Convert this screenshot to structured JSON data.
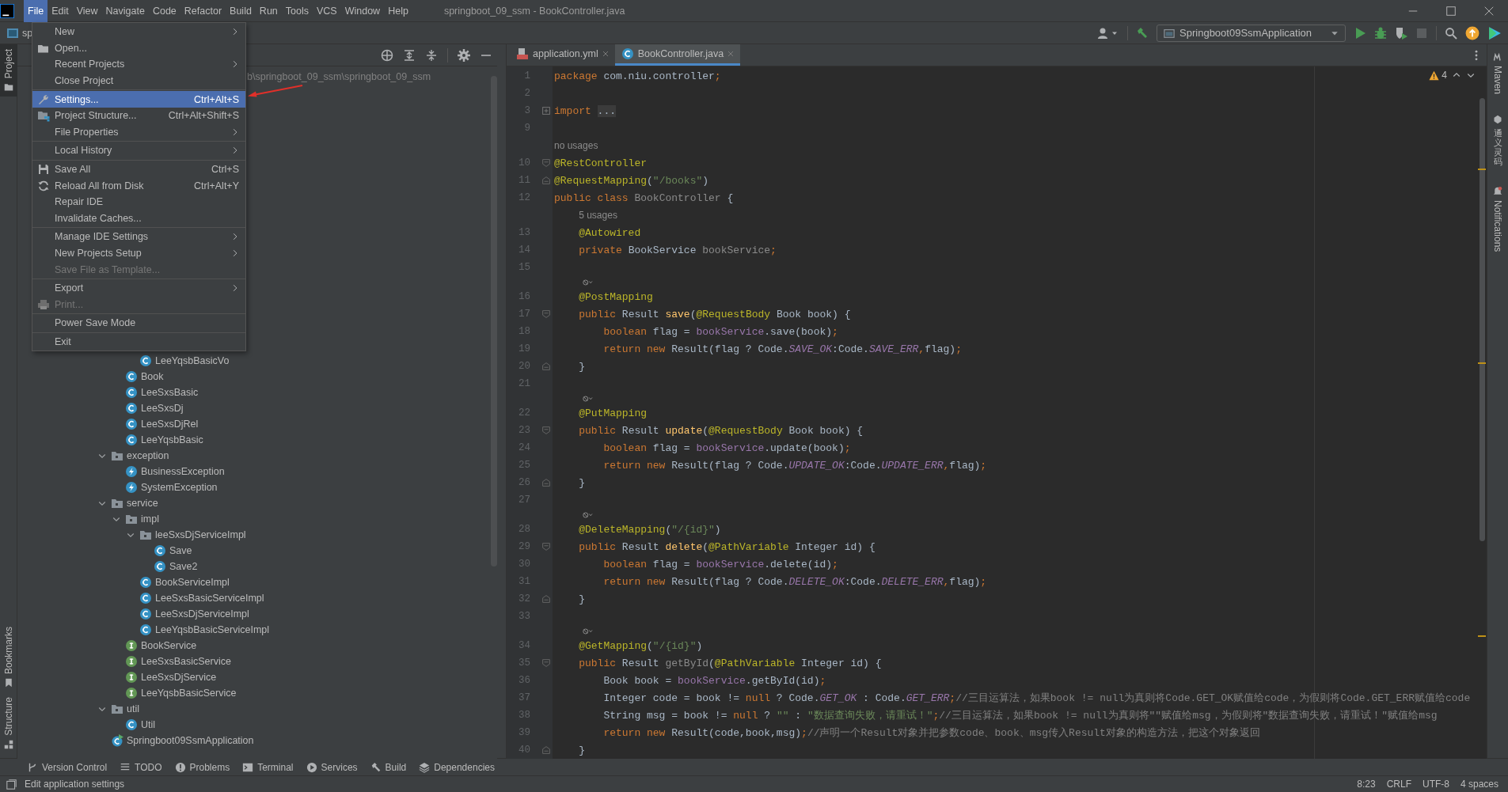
{
  "window": {
    "title": "springboot_09_ssm - BookController.java"
  },
  "menu_bar": [
    {
      "label": "File",
      "selected": true
    },
    {
      "label": "Edit",
      "selected": false
    },
    {
      "label": "View",
      "selected": false
    },
    {
      "label": "Navigate",
      "selected": false
    },
    {
      "label": "Code",
      "selected": false
    },
    {
      "label": "Refactor",
      "selected": false
    },
    {
      "label": "Build",
      "selected": false
    },
    {
      "label": "Run",
      "selected": false
    },
    {
      "label": "Tools",
      "selected": false
    },
    {
      "label": "VCS",
      "selected": false
    },
    {
      "label": "Window",
      "selected": false
    },
    {
      "label": "Help",
      "selected": false
    }
  ],
  "file_menu": {
    "groups": [
      [
        {
          "label": "New",
          "submenu": true,
          "selected": false,
          "disabled": false
        },
        {
          "label": "Open...",
          "submenu": false,
          "selected": false,
          "disabled": false
        },
        {
          "label": "Recent Projects",
          "submenu": true,
          "selected": false,
          "disabled": false
        },
        {
          "label": "Close Project",
          "submenu": false,
          "selected": false,
          "disabled": false
        }
      ],
      [
        {
          "label": "Settings...",
          "shortcut": "Ctrl+Alt+S",
          "submenu": false,
          "selected": true,
          "disabled": false
        },
        {
          "label": "Project Structure...",
          "shortcut": "Ctrl+Alt+Shift+S",
          "submenu": false,
          "selected": false,
          "disabled": false
        },
        {
          "label": "File Properties",
          "submenu": true,
          "selected": false,
          "disabled": false
        }
      ],
      [
        {
          "label": "Local History",
          "submenu": true,
          "selected": false,
          "disabled": false
        }
      ],
      [
        {
          "label": "Save All",
          "shortcut": "Ctrl+S",
          "submenu": false,
          "selected": false,
          "disabled": false
        },
        {
          "label": "Reload All from Disk",
          "shortcut": "Ctrl+Alt+Y",
          "submenu": false,
          "selected": false,
          "disabled": false
        },
        {
          "label": "Repair IDE",
          "submenu": false,
          "selected": false,
          "disabled": false
        },
        {
          "label": "Invalidate Caches...",
          "submenu": false,
          "selected": false,
          "disabled": false
        }
      ],
      [
        {
          "label": "Manage IDE Settings",
          "submenu": true,
          "selected": false,
          "disabled": false
        },
        {
          "label": "New Projects Setup",
          "submenu": true,
          "selected": false,
          "disabled": false
        },
        {
          "label": "Save File as Template...",
          "submenu": false,
          "selected": false,
          "disabled": true
        }
      ],
      [
        {
          "label": "Export",
          "submenu": true,
          "selected": false,
          "disabled": false
        },
        {
          "label": "Print...",
          "submenu": false,
          "selected": false,
          "disabled": true
        }
      ],
      [
        {
          "label": "Power Save Mode",
          "submenu": false,
          "selected": false,
          "disabled": false
        }
      ],
      [
        {
          "label": "Exit",
          "submenu": false,
          "selected": false,
          "disabled": false
        }
      ]
    ]
  },
  "navigation": {
    "breadcrumb": "sp"
  },
  "toolbar": {
    "run_configuration": "Springboot09SsmApplication"
  },
  "left_strip": {
    "top": [
      {
        "label": "Project",
        "selected": true
      }
    ],
    "bottom": [
      {
        "label": "Bookmarks",
        "selected": false
      },
      {
        "label": "Structure",
        "selected": false
      }
    ]
  },
  "project_panel": {
    "path": "b\\springboot_09_ssm\\springboot_09_ssm",
    "tree": [
      {
        "children": [
          {
            "children": [
              {
                "label": "LeeYqsbBasicVo",
                "kind": "class"
              }
            ]
          },
          {
            "label": "Book",
            "kind": "class"
          },
          {
            "label": "LeeSxsBasic",
            "kind": "class"
          },
          {
            "label": "LeeSxsDj",
            "kind": "class"
          },
          {
            "label": "LeeSxsDjRel",
            "kind": "class"
          },
          {
            "label": "LeeYqsbBasic",
            "kind": "class"
          }
        ]
      },
      {
        "label": "exception",
        "kind": "folder",
        "expanded": true,
        "children": [
          {
            "label": "BusinessException",
            "kind": "exception"
          },
          {
            "label": "SystemException",
            "kind": "exception"
          }
        ]
      },
      {
        "label": "service",
        "kind": "folder",
        "expanded": true,
        "children": [
          {
            "label": "impl",
            "kind": "folder",
            "expanded": true,
            "children": [
              {
                "label": "leeSxsDjServiceImpl",
                "kind": "folder",
                "expanded": true,
                "children": [
                  {
                    "label": "Save",
                    "kind": "class"
                  },
                  {
                    "label": "Save2",
                    "kind": "class"
                  }
                ]
              },
              {
                "label": "BookServiceImpl",
                "kind": "class"
              },
              {
                "label": "LeeSxsBasicServiceImpl",
                "kind": "class"
              },
              {
                "label": "LeeSxsDjServiceImpl",
                "kind": "class"
              },
              {
                "label": "LeeYqsbBasicServiceImpl",
                "kind": "class"
              }
            ]
          },
          {
            "label": "BookService",
            "kind": "interface"
          },
          {
            "label": "LeeSxsBasicService",
            "kind": "interface"
          },
          {
            "label": "LeeSxsDjService",
            "kind": "interface"
          },
          {
            "label": "LeeYqsbBasicService",
            "kind": "interface"
          }
        ]
      },
      {
        "label": "util",
        "kind": "folder",
        "expanded": true,
        "children": [
          {
            "label": "Util",
            "kind": "class"
          }
        ]
      },
      {
        "label": "Springboot09SsmApplication",
        "kind": "app"
      }
    ]
  },
  "editor": {
    "tabs": [
      {
        "label": "application.yml",
        "kind": "yaml",
        "selected": false
      },
      {
        "label": "BookController.java",
        "kind": "java",
        "selected": true
      }
    ],
    "warnings": "4",
    "lines": [
      {
        "kind": "code",
        "number": "1",
        "tokens": [
          {
            "kind": "kw",
            "text": "package"
          },
          {
            "kind": "plain",
            "text": " com.niu.controller"
          },
          {
            "kind": "kw",
            "text": ";"
          }
        ]
      },
      {
        "kind": "code",
        "number": "2"
      },
      {
        "kind": "code",
        "number": "3",
        "collapsed": true,
        "tokens": [
          {
            "kind": "kw",
            "text": "import "
          },
          {
            "kind": "folded",
            "text": "..."
          }
        ]
      },
      {
        "kind": "code",
        "number": "9"
      },
      {
        "kind": "hint",
        "text": "no usages"
      },
      {
        "kind": "code",
        "number": "10",
        "fold_start": true,
        "tokens": [
          {
            "kind": "ann",
            "text": "@RestController"
          }
        ]
      },
      {
        "kind": "code",
        "number": "11",
        "fold_end": true,
        "tokens": [
          {
            "kind": "ann",
            "text": "@RequestMapping"
          },
          {
            "kind": "plain",
            "text": "("
          },
          {
            "kind": "str",
            "text": "\"/books\""
          },
          {
            "kind": "plain",
            "text": ")"
          }
        ]
      },
      {
        "kind": "code",
        "number": "12",
        "tokens": [
          {
            "kind": "kw",
            "text": "public class "
          },
          {
            "kind": "dim",
            "text": "BookController"
          },
          {
            "kind": "plain",
            "text": " {"
          }
        ]
      },
      {
        "kind": "hint",
        "text": "5 usages"
      },
      {
        "kind": "code",
        "number": "13",
        "tokens": [
          {
            "kind": "ann",
            "text": "    @Autowired"
          }
        ]
      },
      {
        "kind": "code",
        "number": "14",
        "tokens": [
          {
            "kind": "kw",
            "text": "    private "
          },
          {
            "kind": "plain",
            "text": "BookService "
          },
          {
            "kind": "dim",
            "text": "bookService"
          },
          {
            "kind": "kw",
            "text": ";"
          }
        ]
      },
      {
        "kind": "code",
        "number": "15"
      },
      {
        "kind": "inlay"
      },
      {
        "kind": "code",
        "number": "16",
        "tokens": [
          {
            "kind": "ann",
            "text": "    @PostMapping"
          }
        ]
      },
      {
        "kind": "code",
        "number": "17",
        "fold_start": true,
        "tokens": [
          {
            "kind": "kw",
            "text": "    public "
          },
          {
            "kind": "plain",
            "text": "Result "
          },
          {
            "kind": "method",
            "text": "save"
          },
          {
            "kind": "plain",
            "text": "("
          },
          {
            "kind": "ann",
            "text": "@RequestBody"
          },
          {
            "kind": "plain",
            "text": " Book book) {"
          }
        ]
      },
      {
        "kind": "code",
        "number": "18",
        "tokens": [
          {
            "kind": "kw",
            "text": "        boolean "
          },
          {
            "kind": "plain",
            "text": "flag = "
          },
          {
            "kind": "member",
            "text": "bookService"
          },
          {
            "kind": "plain",
            "text": ".save(book)"
          },
          {
            "kind": "kw",
            "text": ";"
          }
        ]
      },
      {
        "kind": "code",
        "number": "19",
        "tokens": [
          {
            "kind": "kw",
            "text": "        return new "
          },
          {
            "kind": "plain",
            "text": "Result(flag ? Code."
          },
          {
            "kind": "field",
            "text": "SAVE_OK"
          },
          {
            "kind": "plain",
            "text": ":Code."
          },
          {
            "kind": "field",
            "text": "SAVE_ERR"
          },
          {
            "kind": "kw",
            "text": ","
          },
          {
            "kind": "plain",
            "text": "flag)"
          },
          {
            "kind": "kw",
            "text": ";"
          }
        ]
      },
      {
        "kind": "code",
        "number": "20",
        "fold_end": true,
        "tokens": [
          {
            "kind": "plain",
            "text": "    }"
          }
        ]
      },
      {
        "kind": "code",
        "number": "21"
      },
      {
        "kind": "inlay"
      },
      {
        "kind": "code",
        "number": "22",
        "tokens": [
          {
            "kind": "ann",
            "text": "    @PutMapping"
          }
        ]
      },
      {
        "kind": "code",
        "number": "23",
        "fold_start": true,
        "tokens": [
          {
            "kind": "kw",
            "text": "    public "
          },
          {
            "kind": "plain",
            "text": "Result "
          },
          {
            "kind": "method",
            "text": "update"
          },
          {
            "kind": "plain",
            "text": "("
          },
          {
            "kind": "ann",
            "text": "@RequestBody"
          },
          {
            "kind": "plain",
            "text": " Book book) {"
          }
        ]
      },
      {
        "kind": "code",
        "number": "24",
        "tokens": [
          {
            "kind": "kw",
            "text": "        boolean "
          },
          {
            "kind": "plain",
            "text": "flag = "
          },
          {
            "kind": "member",
            "text": "bookService"
          },
          {
            "kind": "plain",
            "text": ".update(book)"
          },
          {
            "kind": "kw",
            "text": ";"
          }
        ]
      },
      {
        "kind": "code",
        "number": "25",
        "tokens": [
          {
            "kind": "kw",
            "text": "        return new "
          },
          {
            "kind": "plain",
            "text": "Result(flag ? Code."
          },
          {
            "kind": "field",
            "text": "UPDATE_OK"
          },
          {
            "kind": "plain",
            "text": ":Code."
          },
          {
            "kind": "field",
            "text": "UPDATE_ERR"
          },
          {
            "kind": "kw",
            "text": ","
          },
          {
            "kind": "plain",
            "text": "flag)"
          },
          {
            "kind": "kw",
            "text": ";"
          }
        ]
      },
      {
        "kind": "code",
        "number": "26",
        "fold_end": true,
        "tokens": [
          {
            "kind": "plain",
            "text": "    }"
          }
        ]
      },
      {
        "kind": "code",
        "number": "27"
      },
      {
        "kind": "inlay"
      },
      {
        "kind": "code",
        "number": "28",
        "tokens": [
          {
            "kind": "ann",
            "text": "    @DeleteMapping"
          },
          {
            "kind": "plain",
            "text": "("
          },
          {
            "kind": "str",
            "text": "\"/{id}\""
          },
          {
            "kind": "plain",
            "text": ")"
          }
        ]
      },
      {
        "kind": "code",
        "number": "29",
        "fold_start": true,
        "tokens": [
          {
            "kind": "kw",
            "text": "    public "
          },
          {
            "kind": "plain",
            "text": "Result "
          },
          {
            "kind": "method",
            "text": "delete"
          },
          {
            "kind": "plain",
            "text": "("
          },
          {
            "kind": "ann",
            "text": "@PathVariable"
          },
          {
            "kind": "plain",
            "text": " Integer id) {"
          }
        ]
      },
      {
        "kind": "code",
        "number": "30",
        "tokens": [
          {
            "kind": "kw",
            "text": "        boolean "
          },
          {
            "kind": "plain",
            "text": "flag = "
          },
          {
            "kind": "member",
            "text": "bookService"
          },
          {
            "kind": "plain",
            "text": ".delete(id)"
          },
          {
            "kind": "kw",
            "text": ";"
          }
        ]
      },
      {
        "kind": "code",
        "number": "31",
        "tokens": [
          {
            "kind": "kw",
            "text": "        return new "
          },
          {
            "kind": "plain",
            "text": "Result(flag ? Code."
          },
          {
            "kind": "field",
            "text": "DELETE_OK"
          },
          {
            "kind": "plain",
            "text": ":Code."
          },
          {
            "kind": "field",
            "text": "DELETE_ERR"
          },
          {
            "kind": "kw",
            "text": ","
          },
          {
            "kind": "plain",
            "text": "flag)"
          },
          {
            "kind": "kw",
            "text": ";"
          }
        ]
      },
      {
        "kind": "code",
        "number": "32",
        "fold_end": true,
        "tokens": [
          {
            "kind": "plain",
            "text": "    }"
          }
        ]
      },
      {
        "kind": "code",
        "number": "33"
      },
      {
        "kind": "inlay"
      },
      {
        "kind": "code",
        "number": "34",
        "tokens": [
          {
            "kind": "ann",
            "text": "    @GetMapping"
          },
          {
            "kind": "plain",
            "text": "("
          },
          {
            "kind": "str",
            "text": "\"/{id}\""
          },
          {
            "kind": "plain",
            "text": ")"
          }
        ]
      },
      {
        "kind": "code",
        "number": "35",
        "fold_start": true,
        "tokens": [
          {
            "kind": "kw",
            "text": "    public "
          },
          {
            "kind": "plain",
            "text": "Result "
          },
          {
            "kind": "dim",
            "text": "getById"
          },
          {
            "kind": "plain",
            "text": "("
          },
          {
            "kind": "ann",
            "text": "@PathVariable"
          },
          {
            "kind": "plain",
            "text": " Integer id) {"
          }
        ]
      },
      {
        "kind": "code",
        "number": "36",
        "tokens": [
          {
            "kind": "plain",
            "text": "        Book book = "
          },
          {
            "kind": "member",
            "text": "bookService"
          },
          {
            "kind": "plain",
            "text": ".getById(id)"
          },
          {
            "kind": "kw",
            "text": ";"
          }
        ]
      },
      {
        "kind": "code",
        "number": "37",
        "tokens": [
          {
            "kind": "plain",
            "text": "        Integer code = book != "
          },
          {
            "kind": "kw",
            "text": "null"
          },
          {
            "kind": "plain",
            "text": " ? Code."
          },
          {
            "kind": "field",
            "text": "GET_OK"
          },
          {
            "kind": "plain",
            "text": " : Code."
          },
          {
            "kind": "field",
            "text": "GET_ERR"
          },
          {
            "kind": "kw",
            "text": ";"
          },
          {
            "kind": "comment",
            "text": "//三目运算法，如果book != null为真则将Code.GET_OK赋值给code，为假则将Code.GET_ERR赋值给code"
          }
        ]
      },
      {
        "kind": "code",
        "number": "38",
        "tokens": [
          {
            "kind": "plain",
            "text": "        String msg = book != "
          },
          {
            "kind": "kw",
            "text": "null"
          },
          {
            "kind": "plain",
            "text": " ? "
          },
          {
            "kind": "str",
            "text": "\"\""
          },
          {
            "kind": "plain",
            "text": " : "
          },
          {
            "kind": "str",
            "text": "\"数据查询失败，请重试！\""
          },
          {
            "kind": "kw",
            "text": ";"
          },
          {
            "kind": "comment",
            "text": "//三目运算法，如果book != null为真则将\"\"赋值给msg，为假则将\"数据查询失败，请重试！\"赋值给msg"
          }
        ]
      },
      {
        "kind": "code",
        "number": "39",
        "tokens": [
          {
            "kind": "kw",
            "text": "        return new "
          },
          {
            "kind": "plain",
            "text": "Result(code,book,msg)"
          },
          {
            "kind": "kw",
            "text": ";"
          },
          {
            "kind": "comment",
            "text": "//声明一个Result对象并把参数code、book、msg传入Result对象的构造方法，把这个对象返回"
          }
        ]
      },
      {
        "kind": "code",
        "number": "40",
        "fold_end": true,
        "tokens": [
          {
            "kind": "plain",
            "text": "    }"
          }
        ]
      }
    ]
  },
  "right_strip": [
    {
      "label": "Maven",
      "kind": "rotated"
    },
    {
      "label": "通义灵码",
      "kind": "stacked"
    },
    {
      "label": "Notifications",
      "kind": "rotated"
    }
  ],
  "tool_windows": [
    "Version Control",
    "TODO",
    "Problems",
    "Terminal",
    "Services",
    "Build",
    "Dependencies"
  ],
  "status_bar": {
    "message": "Edit application settings",
    "items": [
      "8:23",
      "CRLF",
      "UTF-8",
      "4 spaces"
    ]
  }
}
